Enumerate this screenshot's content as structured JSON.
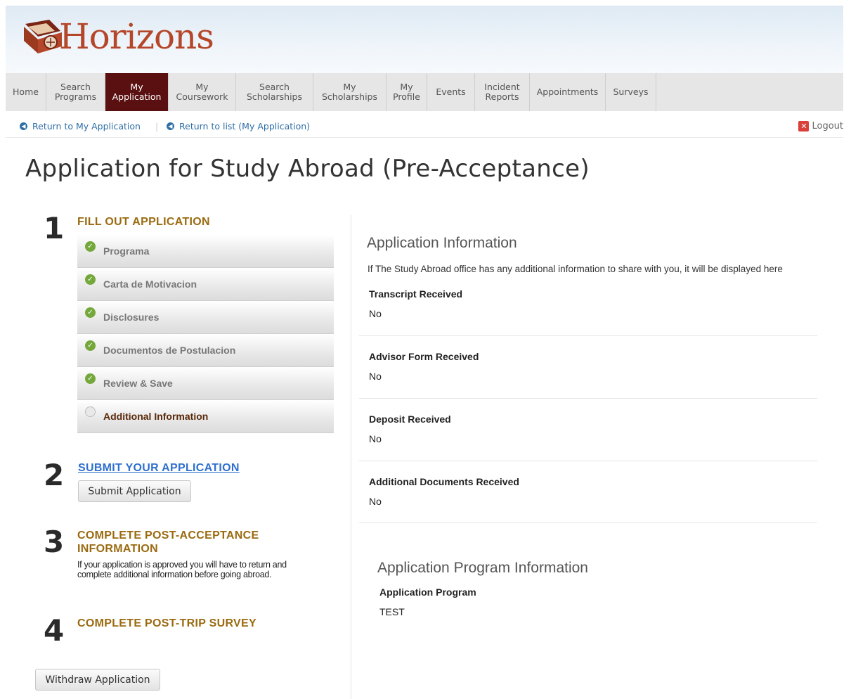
{
  "brand": {
    "name": "Horizons"
  },
  "nav": {
    "items": [
      {
        "label": "Home",
        "active": false
      },
      {
        "label": "Search\nPrograms",
        "active": false
      },
      {
        "label": "My\nApplication",
        "active": true
      },
      {
        "label": "My\nCoursework",
        "active": false
      },
      {
        "label": "Search\nScholarships",
        "active": false
      },
      {
        "label": "My\nScholarships",
        "active": false
      },
      {
        "label": "My\nProfile",
        "active": false
      },
      {
        "label": "Events",
        "active": false
      },
      {
        "label": "Incident\nReports",
        "active": false
      },
      {
        "label": "Appointments",
        "active": false
      },
      {
        "label": "Surveys",
        "active": false
      }
    ]
  },
  "subnav": {
    "return_application": "Return to My Application",
    "separator": "|",
    "return_list": "Return to list (My Application)",
    "logout": "Logout"
  },
  "page": {
    "title": "Application for Study Abroad (Pre-Acceptance)"
  },
  "steps": {
    "s1": {
      "num": "1",
      "heading": "FILL OUT APPLICATION"
    },
    "sections": [
      {
        "label": "Programa",
        "complete": true
      },
      {
        "label": "Carta de Motivacion",
        "complete": true
      },
      {
        "label": "Disclosures",
        "complete": true
      },
      {
        "label": "Documentos de Postulacion",
        "complete": true
      },
      {
        "label": "Review & Save",
        "complete": true
      },
      {
        "label": "Additional Information",
        "complete": false
      }
    ],
    "s2": {
      "num": "2",
      "heading": "SUBMIT YOUR APPLICATION",
      "button": "Submit Application"
    },
    "s3": {
      "num": "3",
      "heading_line1": "COMPLETE POST-ACCEPTANCE",
      "heading_line2": "INFORMATION",
      "text": "If your application is approved you will have to return and complete additional information before going abroad."
    },
    "s4": {
      "num": "4",
      "heading": "COMPLETE POST-TRIP SURVEY"
    },
    "withdraw_button": "Withdraw Application"
  },
  "info": {
    "heading": "Application Information",
    "description": "If The Study Abroad office has any additional information to share with you, it will be displayed here",
    "fields": [
      {
        "label": "Transcript Received",
        "value": "No"
      },
      {
        "label": "Advisor Form Received",
        "value": "No"
      },
      {
        "label": "Deposit Received",
        "value": "No"
      },
      {
        "label": "Additional Documents Received",
        "value": "No"
      }
    ]
  },
  "program_info": {
    "heading": "Application Program Information",
    "label": "Application Program",
    "value": "TEST"
  },
  "colors": {
    "nav_active": "#5a1010",
    "brand": "#b4472a",
    "step_heading": "#9a6a10",
    "link": "#2f6fa6",
    "check": "#74a83a"
  }
}
